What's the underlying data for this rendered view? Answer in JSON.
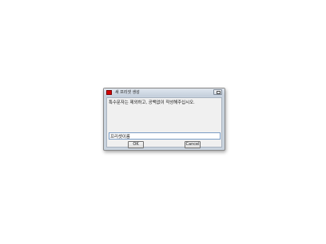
{
  "dialog": {
    "title": "새 프리셋 생성",
    "message": "특수문자는 제외하고, 공백없이 작성해주십시오.",
    "input_value": "프리셋이름",
    "ok_label": "OK",
    "cancel_label": "Cancel",
    "close_icon": "maximize-icon"
  },
  "colors": {
    "app_icon": "#d40000",
    "input_border": "#7a9cc4"
  }
}
